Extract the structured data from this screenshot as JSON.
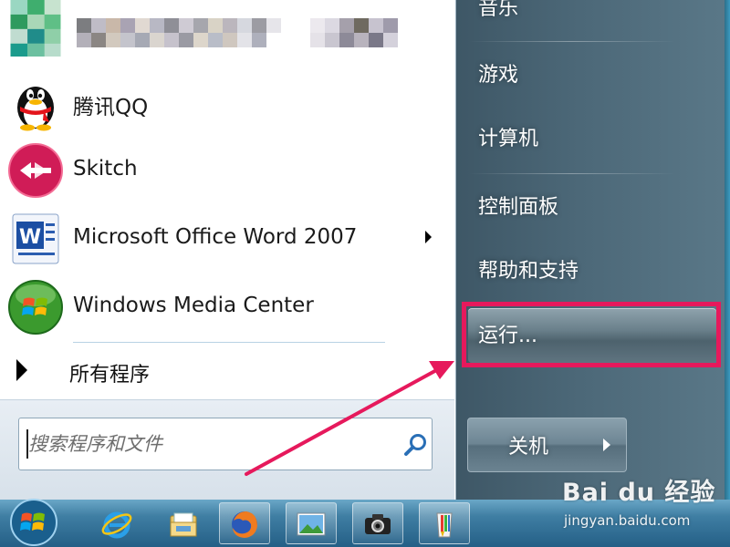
{
  "start_menu": {
    "right": {
      "items": [
        {
          "label": "音乐"
        },
        {
          "label": "游戏"
        },
        {
          "label": "计算机"
        },
        {
          "label": "控制面板"
        },
        {
          "label": "帮助和支持"
        },
        {
          "label": "运行..."
        }
      ],
      "shutdown_label": "关机"
    },
    "programs": [
      {
        "label": "腾讯QQ",
        "icon": "qq-penguin-icon"
      },
      {
        "label": "Skitch",
        "icon": "skitch-icon"
      },
      {
        "label": "Microsoft Office Word 2007",
        "icon": "word-icon",
        "has_submenu": true
      },
      {
        "label": "Windows Media Center",
        "icon": "windows-media-center-icon"
      }
    ],
    "all_programs_label": "所有程序",
    "search": {
      "placeholder": "搜索程序和文件"
    }
  },
  "annotation": {
    "highlight_color": "#e6195c"
  },
  "watermark": {
    "brand_text": "Bai du 经验",
    "url": "jingyan.baidu.com"
  },
  "taskbar": {
    "icons": [
      "windows-start-orb",
      "internet-explorer-icon",
      "windows-explorer-icon",
      "firefox-icon",
      "image-viewer-icon",
      "camera-icon",
      "paint-icon"
    ]
  }
}
